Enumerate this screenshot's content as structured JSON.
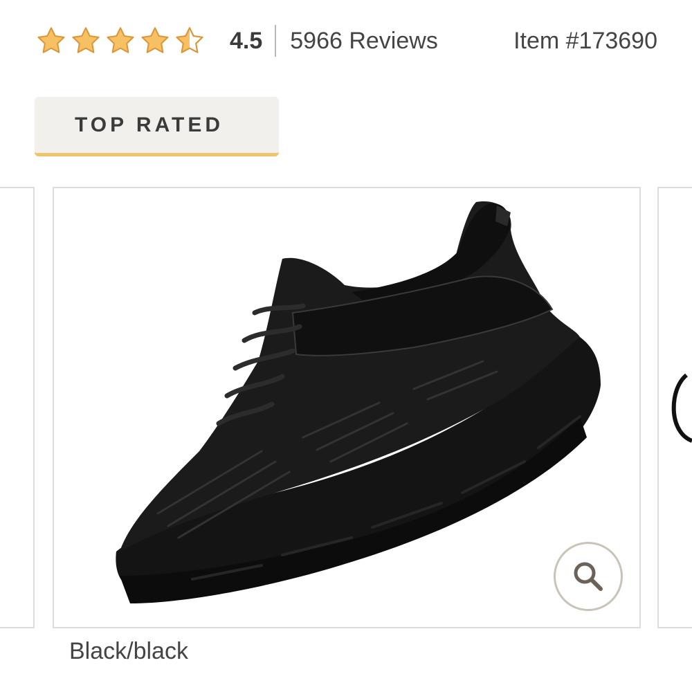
{
  "rating": {
    "stars": 4.5,
    "max_stars": 5,
    "value_text": "4.5",
    "reviews_text": "5966 Reviews"
  },
  "item": {
    "number_text": "Item #173690"
  },
  "badge": {
    "label": "TOP RATED"
  },
  "gallery": {
    "current_color": "Black/black",
    "zoom_icon": "magnifier-icon"
  },
  "colors": {
    "star_fill": "#f7c063",
    "star_stroke": "#d9963a",
    "badge_bg": "#f1f0ec",
    "badge_underline": "#f2c46a",
    "frame_border": "#dcdcdc",
    "zoom_border": "#c9c3b8"
  }
}
